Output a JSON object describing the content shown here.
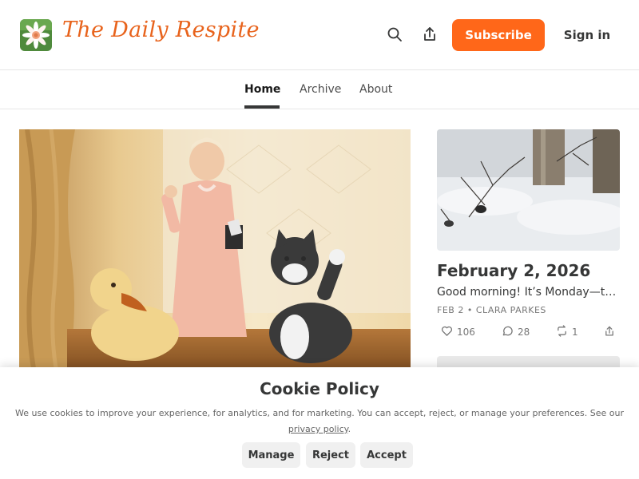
{
  "header": {
    "site_title": "The Daily Respite",
    "subscribe_label": "Subscribe",
    "signin_label": "Sign in"
  },
  "nav": {
    "items": [
      {
        "label": "Home",
        "active": true
      },
      {
        "label": "Archive",
        "active": false
      },
      {
        "label": "About",
        "active": false
      }
    ]
  },
  "side_post": {
    "title": "February 2, 2026",
    "subtitle": "Good morning! It’s Monday—the second day of February, and the new week begins.",
    "date": "FEB 2",
    "author": "CLARA PARKES",
    "likes": "106",
    "comments": "28",
    "restacks": "1"
  },
  "cookie": {
    "title": "Cookie Policy",
    "text": "We use cookies to improve your experience, for analytics, and for marketing. You can accept, reject, or manage your preferences. See our",
    "link_text": "privacy policy",
    "manage_label": "Manage",
    "reject_label": "Reject",
    "accept_label": "Accept"
  },
  "colors": {
    "accent": "#ff6719",
    "title": "#e8631c",
    "text": "#363737"
  }
}
